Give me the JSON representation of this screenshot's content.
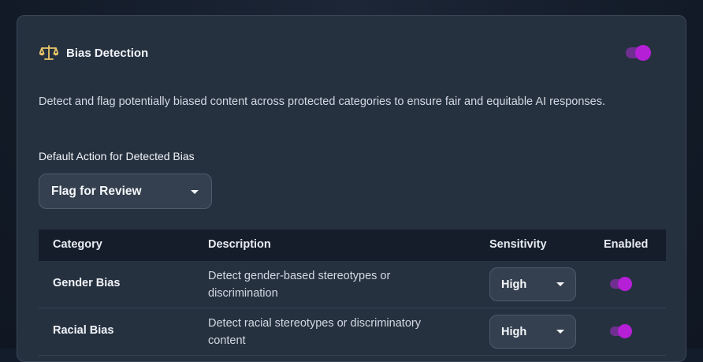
{
  "panel": {
    "icon": "scale-icon",
    "title": "Bias Detection",
    "enabled": true,
    "description": "Detect and flag potentially biased content across protected categories to ensure fair and equitable AI responses."
  },
  "default_action": {
    "label": "Default Action for Detected Bias",
    "selected": "Flag for Review"
  },
  "table": {
    "headers": {
      "category": "Category",
      "description": "Description",
      "sensitivity": "Sensitivity",
      "enabled": "Enabled"
    },
    "rows": [
      {
        "category": "Gender Bias",
        "description": "Detect gender-based stereotypes or discrimination",
        "sensitivity": "High",
        "enabled": true
      },
      {
        "category": "Racial Bias",
        "description": "Detect racial stereotypes or discriminatory content",
        "sensitivity": "High",
        "enabled": true
      }
    ]
  },
  "colors": {
    "accent": "#b51fd6",
    "accent_track": "#6f2f90",
    "icon": "#e8c56a",
    "card_bg": "#263140",
    "header_bg": "#151d2b"
  }
}
